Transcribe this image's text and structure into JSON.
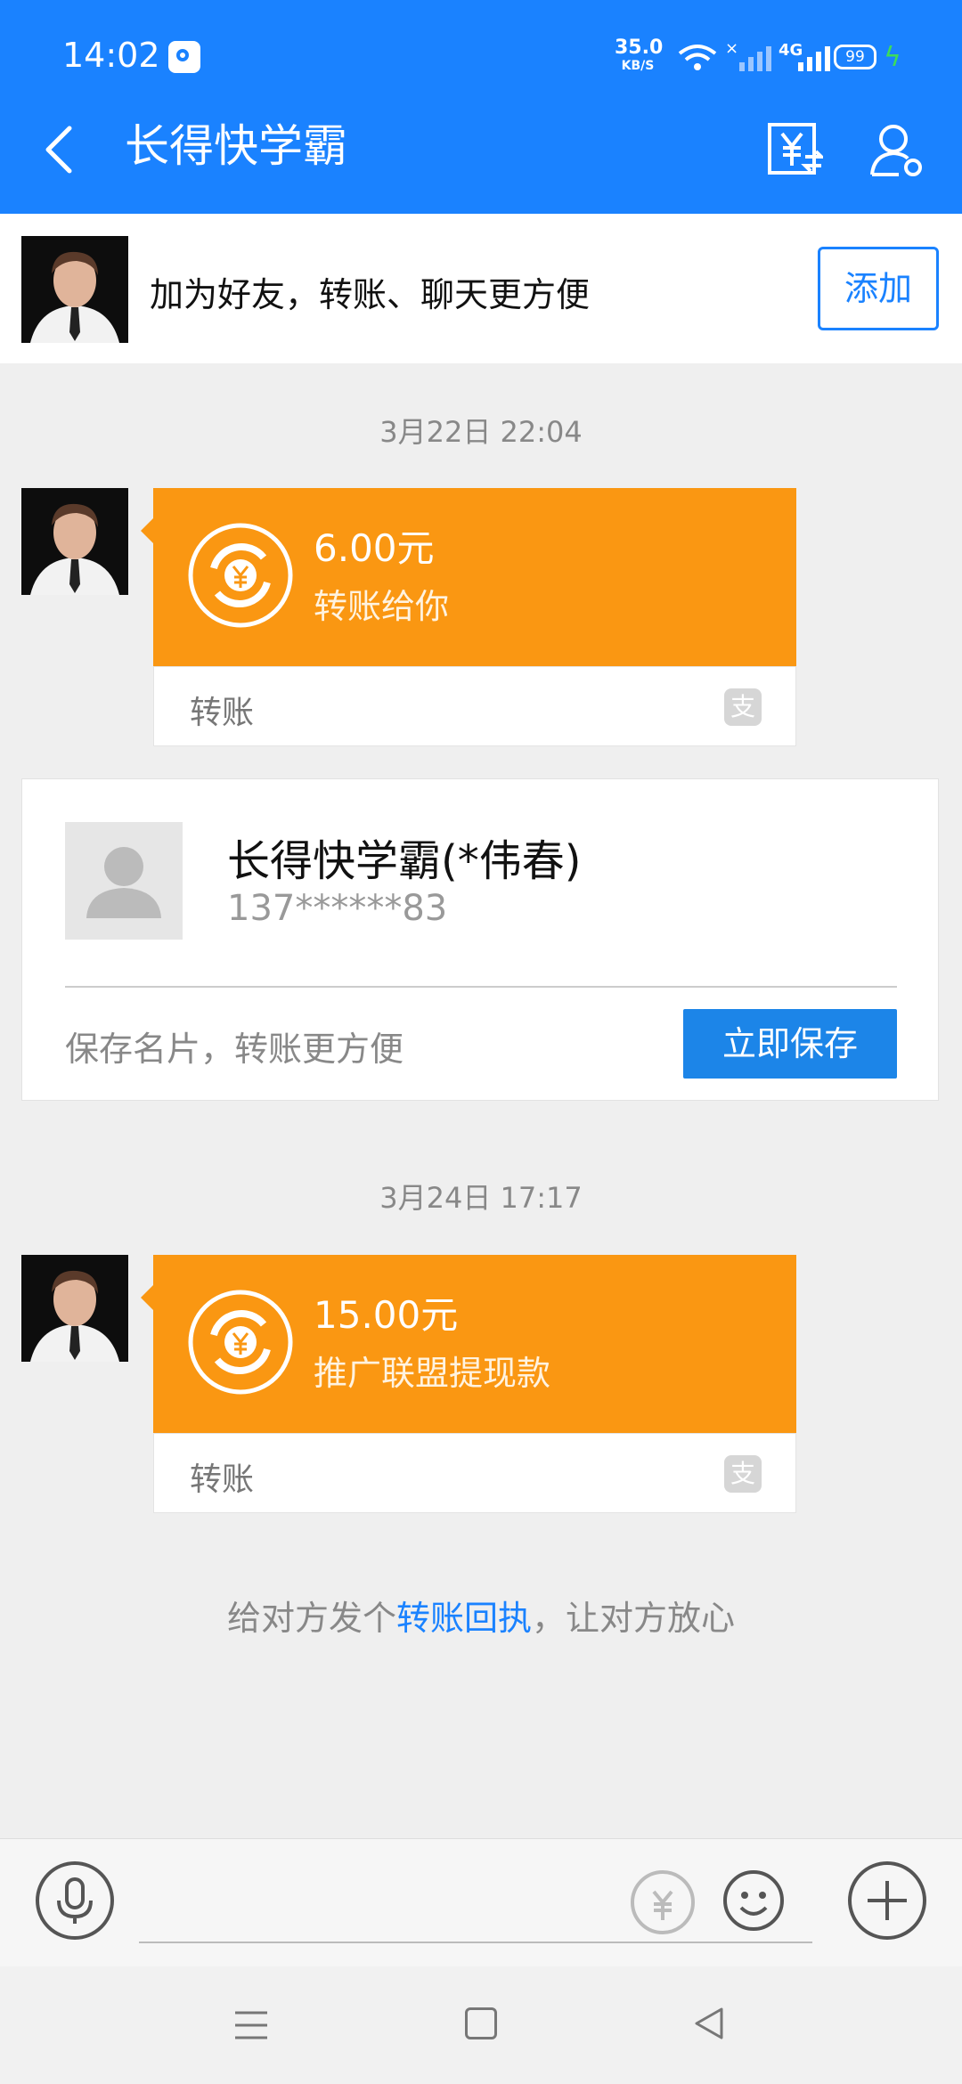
{
  "status_bar": {
    "time": "14:02",
    "speed_value": "35.0",
    "speed_unit": "KB/S",
    "network": "4G",
    "battery": "99"
  },
  "header": {
    "title": "长得快学霸",
    "back_icon": "chevron-left-icon",
    "transfer_icon": "yuan-transfer-icon",
    "profile_icon": "person-settings-icon"
  },
  "banner": {
    "text": "加为好友，转账、聊天更方便",
    "add_label": "添加"
  },
  "messages": [
    {
      "time": "3月22日 22:04",
      "amount": "6.00元",
      "desc": "转账给你",
      "label": "转账"
    },
    {
      "time": "3月24日 17:17",
      "amount": "15.00元",
      "desc": "推广联盟提现款",
      "label": "转账"
    }
  ],
  "contact_card": {
    "name": "长得快学霸(*伟春)",
    "phone": "137******83",
    "hint": "保存名片，转账更方便",
    "save_label": "立即保存"
  },
  "receipt_hint": {
    "prefix": "给对方发个",
    "link": "转账回执",
    "suffix": "，让对方放心"
  },
  "input_bar": {
    "placeholder": "",
    "alipay_glyph": "支"
  },
  "colors": {
    "primary": "#1a82ff",
    "transfer_orange": "#fa9712"
  }
}
